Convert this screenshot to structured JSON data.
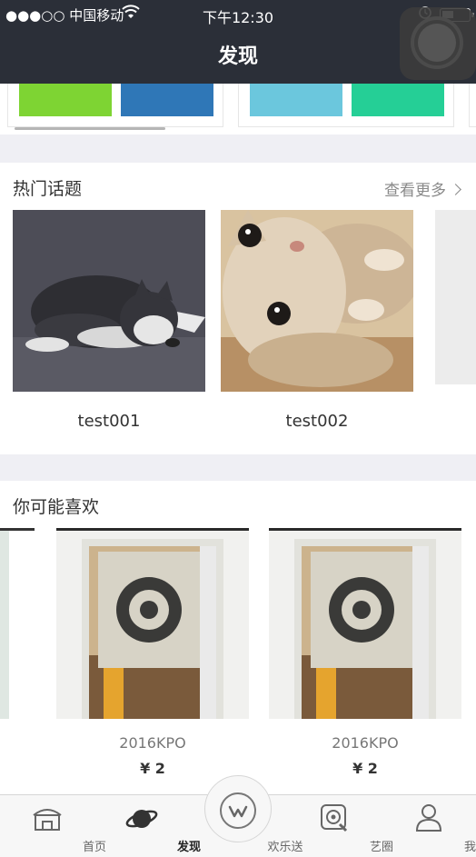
{
  "status_bar": {
    "carrier": "●●●○○ 中国移动",
    "time": "下午12:30"
  },
  "nav": {
    "title": "发现"
  },
  "color_swatches": [
    "#7ed433",
    "#2f77b7",
    "#6bc7dd",
    "#25cf96"
  ],
  "hot_topics": {
    "title": "热门话题",
    "more_label": "查看更多",
    "items": [
      {
        "caption": "test001",
        "image": "husky-puppy-photo"
      },
      {
        "caption": "test002",
        "image": "kitten-photo"
      }
    ]
  },
  "recommend": {
    "title": "你可能喜欢",
    "items": [
      {
        "name": "2016KPO",
        "price": "¥ 2",
        "image": "curtain-photo"
      },
      {
        "name": "2016KPO",
        "price": "¥ 2",
        "image": "curtain-photo"
      }
    ]
  },
  "tabbar": {
    "tabs": [
      {
        "label": "首页",
        "icon": "home-icon"
      },
      {
        "label": "发现",
        "icon": "planet-icon",
        "active": true
      },
      {
        "label": "欢乐送",
        "icon": "w-logo-icon"
      },
      {
        "label": "艺圈",
        "icon": "target-icon"
      },
      {
        "label": "我的",
        "icon": "user-icon"
      }
    ]
  }
}
